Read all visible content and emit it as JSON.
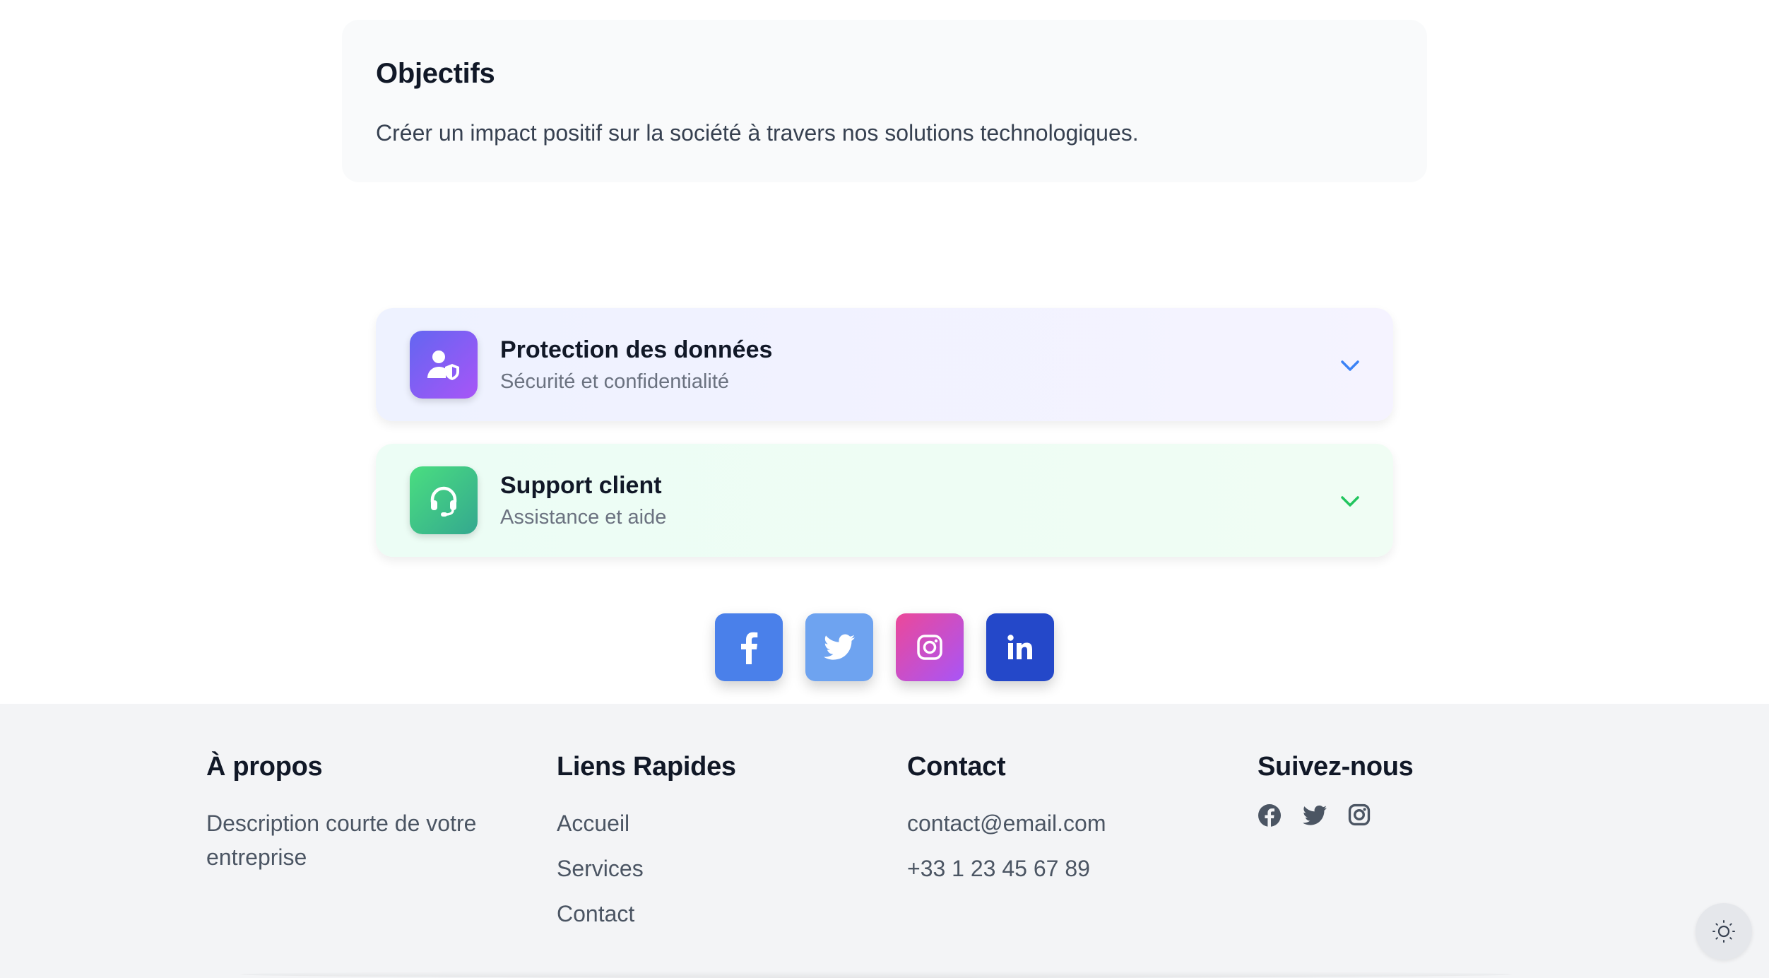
{
  "objectives": {
    "title": "Objectifs",
    "text": "Créer un impact positif sur la société à travers nos solutions technologiques."
  },
  "accordions": [
    {
      "title": "Protection des données",
      "subtitle": "Sécurité et confidentialité",
      "icon": "user-shield-icon",
      "accent": "#6366f1"
    },
    {
      "title": "Support client",
      "subtitle": "Assistance et aide",
      "icon": "headset-icon",
      "accent": "#4ade80"
    }
  ],
  "social": [
    {
      "name": "facebook-icon",
      "color": "#4a80ea"
    },
    {
      "name": "twitter-icon",
      "color": "#6ea3f0"
    },
    {
      "name": "instagram-icon",
      "color": "#d946ef"
    },
    {
      "name": "linkedin-icon",
      "color": "#2448c9"
    }
  ],
  "footer": {
    "about": {
      "title": "À propos",
      "text": "Description courte de votre entreprise"
    },
    "links": {
      "title": "Liens Rapides",
      "items": [
        "Accueil",
        "Services",
        "Contact"
      ]
    },
    "contact": {
      "title": "Contact",
      "email": "contact@email.com",
      "phone": "+33 1 23 45 67 89"
    },
    "follow": {
      "title": "Suivez-nous",
      "icons": [
        "facebook-icon",
        "twitter-icon",
        "instagram-icon"
      ]
    }
  },
  "theme_toggle": {
    "icon": "sun-icon"
  }
}
